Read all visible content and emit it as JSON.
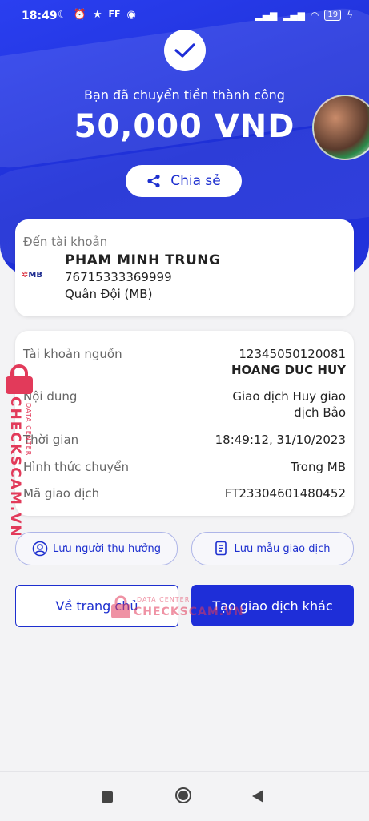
{
  "status_bar": {
    "time": "18:49",
    "left_icons": [
      "moon-icon",
      "alarm-icon",
      "app-icon",
      "ff-icon",
      "messenger-icon"
    ],
    "battery": "19"
  },
  "header": {
    "success_text": "Bạn đã chuyển tiền thành công",
    "amount": "50,000 VND",
    "share_label": "Chia sẻ"
  },
  "destination": {
    "label": "Đến tài khoản",
    "bank_logo": "MB",
    "name": "PHAM MINH TRUNG",
    "account": "76715333369999",
    "bank": "Quân Đội (MB)"
  },
  "details": {
    "rows": [
      {
        "label": "Tài khoản nguồn",
        "value": "12345050120081",
        "value2": "HOANG DUC HUY"
      },
      {
        "label": "Nội dung",
        "value": "Giao dịch Huy giao",
        "value2": "dịch Bảo"
      },
      {
        "label": "Thời gian",
        "value": "18:49:12, 31/10/2023"
      },
      {
        "label": "Hình thức chuyển",
        "value": "Trong MB"
      },
      {
        "label": "Mã giao dịch",
        "value": "FT23304601480452"
      }
    ]
  },
  "actions": {
    "save_beneficiary": "Lưu người thụ hưởng",
    "save_template": "Lưu mẫu giao dịch",
    "home": "Về trang chủ",
    "new_transaction": "Tạo giao dịch khác"
  },
  "watermark": {
    "brand": "CHECKSCAM.VN",
    "sub": "DATA CENTER"
  },
  "colors": {
    "primary": "#1e2ed8",
    "watermark": "#e23a5a",
    "background": "#f3f3f5"
  }
}
